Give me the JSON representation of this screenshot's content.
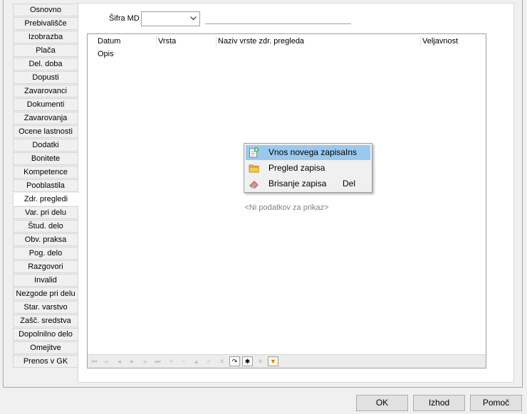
{
  "sidebar": {
    "tabs": [
      "Osnovno",
      "Prebivališče",
      "Izobrazba",
      "Plača",
      "Del. doba",
      "Dopusti",
      "Zavarovanci",
      "Dokumenti",
      "Zavarovanja",
      "Ocene lastnosti",
      "Dodatki",
      "Bonitete",
      "Kompetence",
      "Pooblastila",
      "Zdr. pregledi",
      "Var. pri delu",
      "Štud. delo",
      "Obv. praksa",
      "Pog. delo",
      "Razgovori",
      "Invalid",
      "Nezgode pri delu",
      "Star. varstvo",
      "Zašč. sredstva",
      "Dopolnilno delo",
      "Omejitve",
      "Prenos v GK"
    ],
    "active": "Zdr. pregledi"
  },
  "filter": {
    "label": "Šifra MD",
    "value": ""
  },
  "grid": {
    "columns": [
      "Datum",
      "Vrsta",
      "Naziv vrste zdr. pregleda",
      "Veljavnost"
    ],
    "second_row_column": "Opis",
    "empty_text": "<Ni podatkov za prikaz>",
    "navigator": {
      "buttons": [
        "first",
        "prev-page",
        "prev",
        "next",
        "next-page",
        "last",
        "insert",
        "delete",
        "edit",
        "post",
        "cancel",
        "refresh",
        "bookmark",
        "goto-bookmark",
        "filter"
      ]
    }
  },
  "context_menu": {
    "items": [
      {
        "label": "Vnos novega zapisa",
        "shortcut": "Ins",
        "icon": "new-record-icon",
        "highlighted": true
      },
      {
        "label": "Pregled zapisa",
        "shortcut": "",
        "icon": "folder-icon",
        "highlighted": false
      },
      {
        "label": "Brisanje zapisa",
        "shortcut": "Del",
        "icon": "eraser-icon",
        "highlighted": false
      }
    ]
  },
  "buttons": {
    "ok": "OK",
    "exit": "Izhod",
    "help": "Pomoč"
  }
}
